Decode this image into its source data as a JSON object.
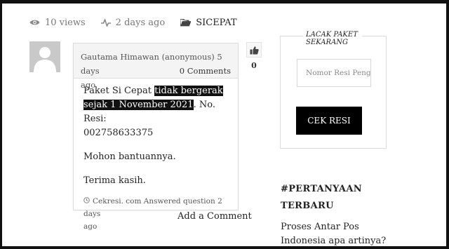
{
  "meta": {
    "views": "10 views",
    "posted": "2 days ago",
    "category": "SICEPAT"
  },
  "question": {
    "author_line": "Gautama Himawan (anonymous) 5 days",
    "age_tail": "ago",
    "comments": "0 Comments",
    "text_a": "Paket Si Cepat ",
    "text_highlight": "tidak bergerak sejak 1 November 2021",
    "text_b": ". No. Resi:",
    "resi": "002758633375",
    "p2": "Mohon bantuannya.",
    "p3": "Terima kasih.",
    "answered_line": "Cekresi. com Answered question 2 days",
    "answered_tail": "ago"
  },
  "vote": {
    "count": "0"
  },
  "actions": {
    "add_comment": "Add a Comment"
  },
  "widget": {
    "title": "LACAK PAKET SEKARANG",
    "input_placeholder": "Nomor Resi Pengiriman",
    "button": "CEK RESI"
  },
  "sidebar": {
    "heading": "#PERTANYAAN TERBARU",
    "link1": "Proses Antar Pos Indonesia apa artinya?"
  },
  "icons": [
    "eye-icon",
    "activity-icon",
    "folder-icon",
    "thumbs-up-icon",
    "clock-icon",
    "avatar-icon"
  ],
  "colors": {
    "highlight_bg": "#111111",
    "button_bg": "#000000",
    "border": "#dcdcdc"
  }
}
